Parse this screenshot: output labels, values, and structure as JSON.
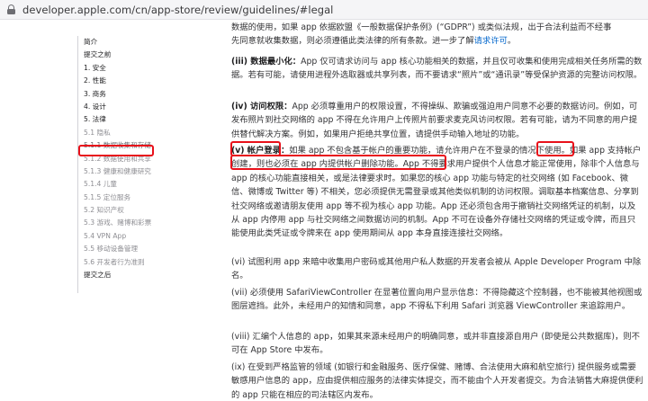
{
  "browser": {
    "url": "developer.apple.com/cn/app-store/review/guidelines/#legal"
  },
  "sidebar": {
    "items": [
      {
        "label": "简介",
        "level": "top"
      },
      {
        "label": "提交之前",
        "level": "top"
      },
      {
        "label": "1. 安全",
        "level": "top"
      },
      {
        "label": "2. 性能",
        "level": "top"
      },
      {
        "label": "3. 商务",
        "level": "top"
      },
      {
        "label": "4. 设计",
        "level": "top"
      },
      {
        "label": "5. 法律",
        "level": "top"
      },
      {
        "label": "5.1 隐私",
        "level": "sub"
      },
      {
        "label": "5.1.1 数据收集和存储",
        "level": "active"
      },
      {
        "label": "5.1.2 数据使用和共享",
        "level": "sub"
      },
      {
        "label": "5.1.3 健康和健康研究",
        "level": "sub"
      },
      {
        "label": "5.1.4 儿童",
        "level": "sub"
      },
      {
        "label": "5.1.5 定位服务",
        "level": "sub"
      },
      {
        "label": "5.2 知识产权",
        "level": "sub"
      },
      {
        "label": "5.3 游戏、赌博和彩票",
        "level": "sub"
      },
      {
        "label": "5.4 VPN App",
        "level": "sub"
      },
      {
        "label": "5.5 移动设备管理",
        "level": "sub"
      },
      {
        "label": "5.6 开发者行为准则",
        "level": "sub"
      },
      {
        "label": "提交之后",
        "level": "top"
      }
    ]
  },
  "content": {
    "p_intro_1": "数据的使用，如果 app 依据欧盟《一般数据保护条例》(“GDPR”) 或类似法规，出于合法利益而不经事",
    "p_intro_2": "先同意就收集数据，则必须遵循此类法律的所有条款。进一步了解",
    "p_intro_link": "请求许可",
    "p_intro_end": "。",
    "p3_label": "(iii) 数据最小化：",
    "p3_body": "App 仅可请求访问与 app 核心功能相关的数据，并且仅可收集和使用完成相关任务所需的数据。若有可能，请使用进程外选取器或共享列表，而不要请求“照片”或“通讯录”等受保护资源的完整访问权限。",
    "p4_label": "(iv) 访问权限：",
    "p4_body": "App 必须尊重用户的权限设置，不得操纵、欺骗或强迫用户同意不必要的数据访问。例如，可发布照片到社交网络的 app 不得在允许用户上传照片前要求麦克风访问权限。若有可能，请为不同意的用户提供替代解决方案。例如，如果用户拒绝共享位置，请提供手动输入地址的功能。",
    "p5_num": "(v) ",
    "p5_label": "帐户登录：",
    "p5_a": "如果 app 不包含基于帐户的重要功能，请允许用户在不登录的情况下使用。",
    "p5_b": "如果 app 支持帐户创建，则也必须在 app 内提供帐户删除功能。",
    "p5_c": "App 不得要求用户提供个人信息才能正常使用，除非个人信息与 app 的核心功能直接相关，或是法律要求时。如果您的核心 app 功能与特定的社交网络 (如 Facebook、微信、微博或 Twitter 等) 不相关，您必须提供无需登录或其他类似机制的访问权限。调取基本档案信息、分享到社交网络或邀请朋友使用 app 等不视为核心 app 功能。App 还必须包含用于撤销社交网络凭证的机制，以及从 app 内停用 app 与社交网络之间数据访问的机制。App 不可在设备外存储社交网络的凭证或令牌，而且只能使用此类凭证或令牌来在 app 使用期间从 app 本身直接连接社交网络。",
    "p6": "(vi) 试图利用 app 来暗中收集用户密码或其他用户私人数据的开发者会被从 Apple Developer Program 中除名。",
    "p7": "(vii) 必须使用 SafariViewController 在显著位置向用户显示信息：不得隐藏这个控制器，也不能被其他视图或图层遮挡。此外，未经用户的知情和同意，app 不得私下利用 Safari 浏览器 ViewController 来追踪用户。",
    "p8": "(viii) 汇编个人信息的 app，如果其来源未经用户的明确同意，或并非直接源自用户 (即使是公共数据库)，则不可在 App Store 中发布。",
    "p9": "(ix) 在受到严格监管的领域 (如银行和金融服务、医疗保健、赌博、合法使用大麻和航空旅行) 提供服务或需要敏感用户信息的 app，应由提供相应服务的法律实体提交，而不能由个人开发者提交。为合法销售大麻提供便利的 app 只能在相应的司法辖区内发布。"
  },
  "colors": {
    "highlight": "#e8101a",
    "link": "#0066cc",
    "text": "#333336"
  }
}
